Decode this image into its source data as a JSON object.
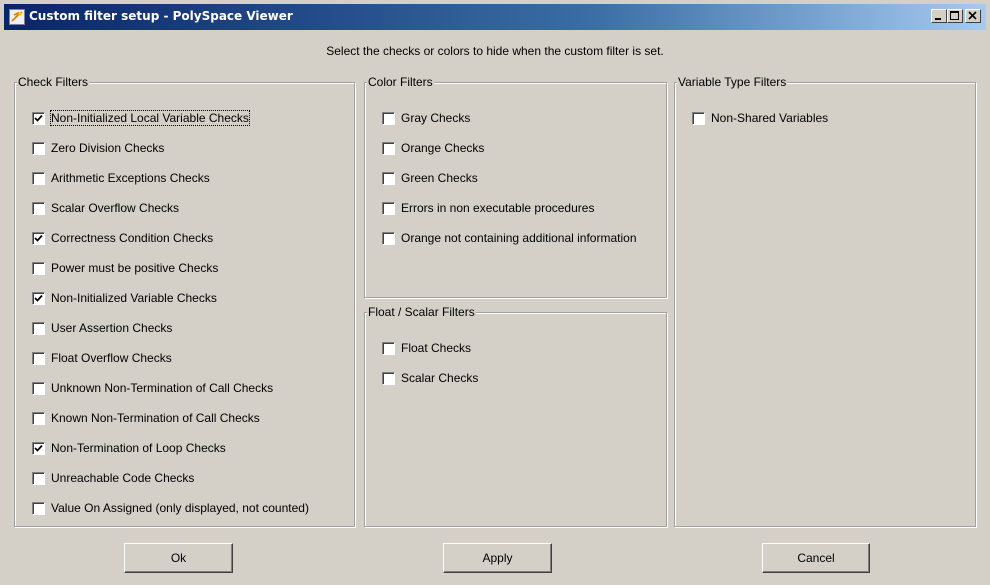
{
  "window": {
    "title": "Custom filter setup - PolySpace Viewer",
    "minimize_icon": "minimize-icon",
    "maximize_icon": "maximize-icon",
    "close_icon": "close-icon"
  },
  "instructions": "Select the checks or colors to hide when the custom filter is set.",
  "check_filters": {
    "title": "Check Filters",
    "items": [
      {
        "label": "Non-Initialized Local Variable Checks",
        "checked": true,
        "focused": true
      },
      {
        "label": "Zero Division Checks",
        "checked": false
      },
      {
        "label": "Arithmetic Exceptions Checks",
        "checked": false
      },
      {
        "label": "Scalar Overflow Checks",
        "checked": false
      },
      {
        "label": "Correctness Condition Checks",
        "checked": true
      },
      {
        "label": "Power must be positive Checks",
        "checked": false
      },
      {
        "label": "Non-Initialized Variable Checks",
        "checked": true
      },
      {
        "label": "User Assertion Checks",
        "checked": false
      },
      {
        "label": "Float Overflow Checks",
        "checked": false
      },
      {
        "label": "Unknown Non-Termination of Call Checks",
        "checked": false
      },
      {
        "label": "Known Non-Termination of Call Checks",
        "checked": false
      },
      {
        "label": "Non-Termination of Loop Checks",
        "checked": true
      },
      {
        "label": "Unreachable Code Checks",
        "checked": false
      },
      {
        "label": "Value On Assigned (only displayed, not counted)",
        "checked": false
      }
    ]
  },
  "color_filters": {
    "title": "Color Filters",
    "items": [
      {
        "label": "Gray Checks",
        "checked": false
      },
      {
        "label": "Orange  Checks",
        "checked": false
      },
      {
        "label": "Green Checks",
        "checked": false
      },
      {
        "label": "Errors in non executable procedures",
        "checked": false
      },
      {
        "label": "Orange not containing additional information",
        "checked": false
      }
    ]
  },
  "float_scalar_filters": {
    "title": "Float / Scalar Filters",
    "items": [
      {
        "label": "Float Checks",
        "checked": false
      },
      {
        "label": "Scalar Checks",
        "checked": false
      }
    ]
  },
  "variable_type_filters": {
    "title": "Variable Type Filters",
    "items": [
      {
        "label": "Non-Shared Variables",
        "checked": false
      }
    ]
  },
  "buttons": {
    "ok": "Ok",
    "apply": "Apply",
    "cancel": "Cancel"
  }
}
